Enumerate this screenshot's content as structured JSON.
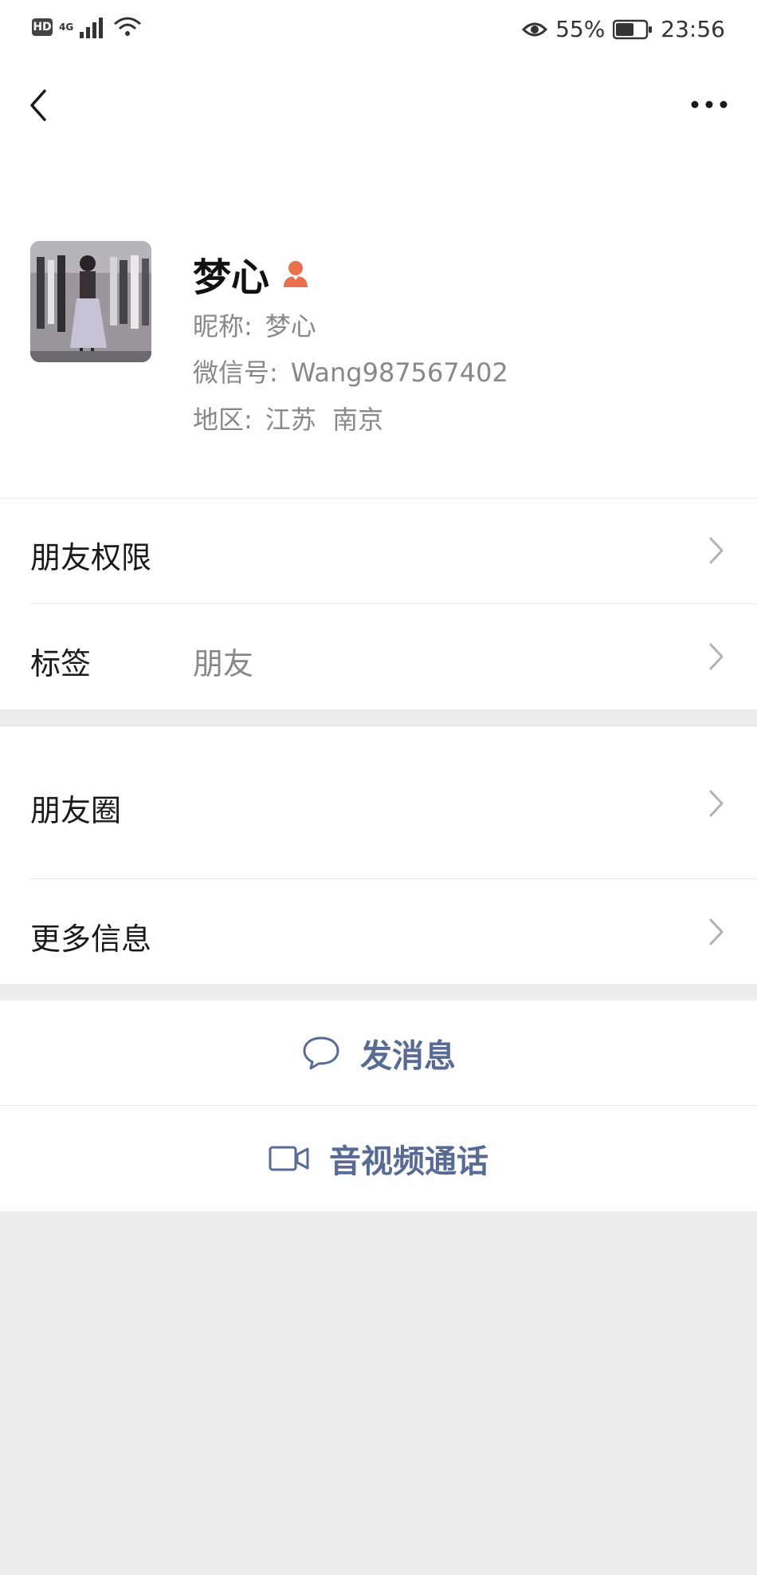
{
  "status_bar": {
    "left_badge": "HD",
    "network": "4G",
    "battery_percent": "55%",
    "time": "23:56"
  },
  "nav": {
    "back_icon": "chevron-left-icon",
    "more_icon": "more-dots-icon"
  },
  "profile": {
    "display_name": "梦心",
    "gender_icon": "female-icon",
    "nickname_label": "昵称:",
    "nickname_value": "梦心",
    "wechat_id_label": "微信号:",
    "wechat_id_value": "Wang987567402",
    "region_label": "地区:",
    "region_value": "江苏  南京"
  },
  "group1": {
    "permissions_label": "朋友权限",
    "tags_label": "标签",
    "tags_value": "朋友"
  },
  "group2": {
    "moments_label": "朋友圈",
    "more_info_label": "更多信息"
  },
  "actions": {
    "send_message_label": "发消息",
    "video_call_label": "音视频通话"
  },
  "colors": {
    "link_blue": "#576b95",
    "background_gray": "#ededed",
    "female_icon": "#e8704e"
  }
}
